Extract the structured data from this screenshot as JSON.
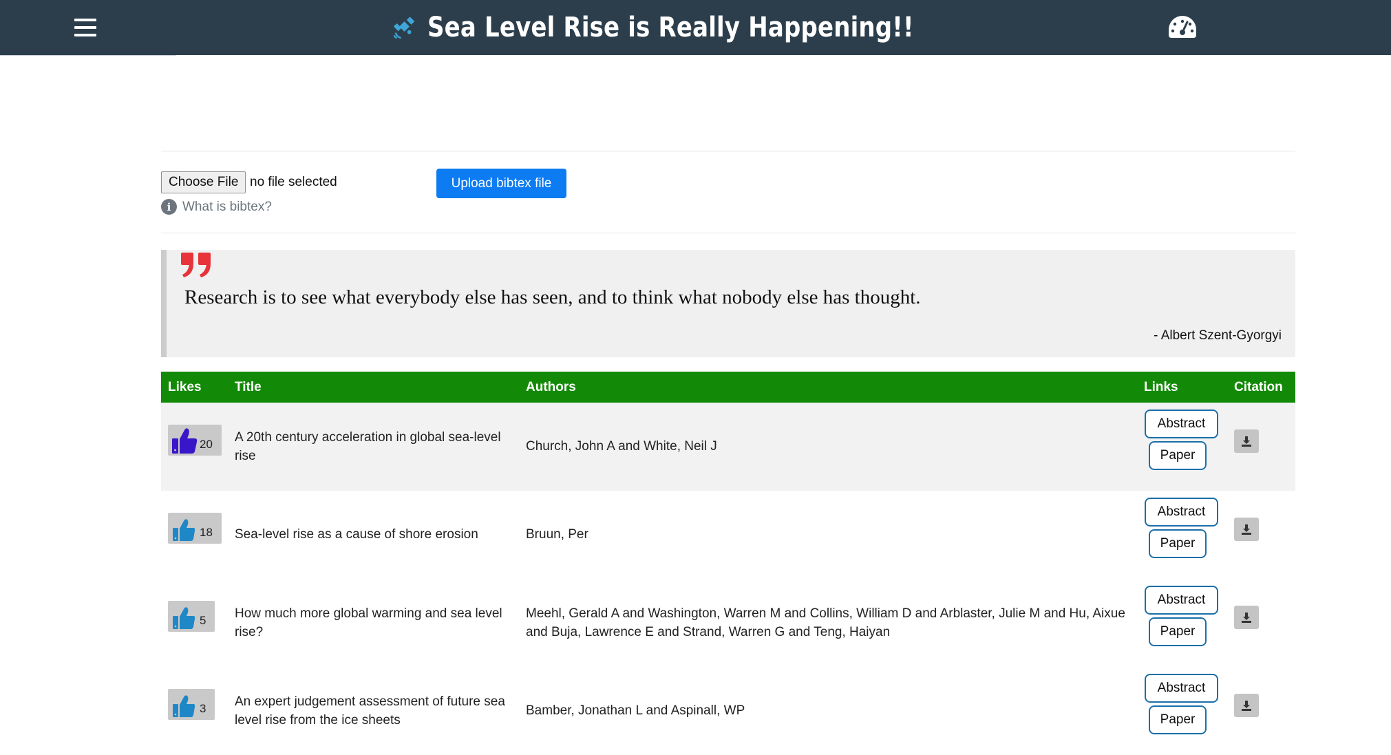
{
  "header": {
    "title": "Sea Level Rise is Really Happening!!",
    "menu_icon": "hamburger-menu-icon",
    "brand_icon": "satellite-icon",
    "dashboard_icon": "dashboard-gauge-icon"
  },
  "upload": {
    "choose_label": "Choose File",
    "file_status": "no file selected",
    "upload_label": "Upload bibtex file",
    "info_label": "What is bibtex?"
  },
  "quote": {
    "text": "Research is to see what everybody else has seen, and to think what nobody else has thought.",
    "author": "- Albert Szent-Gyorgyi",
    "accent_color": "#e8333b"
  },
  "table": {
    "header_color": "#138a07",
    "columns": [
      "Likes",
      "Title",
      "Authors",
      "Links",
      "Citation"
    ],
    "abstract_label": "Abstract",
    "paper_label": "Paper",
    "rows": [
      {
        "likes": "20",
        "title": "A 20th century acceleration in global sea-level rise",
        "authors": "Church, John A and White, Neil J"
      },
      {
        "likes": "18",
        "title": "Sea-level rise as a cause of shore erosion",
        "authors": "Bruun, Per"
      },
      {
        "likes": "5",
        "title": "How much more global warming and sea level rise?",
        "authors": "Meehl, Gerald A and Washington, Warren M and Collins, William D and Arblaster, Julie M and Hu, Aixue and Buja, Lawrence E and Strand, Warren G and Teng, Haiyan"
      },
      {
        "likes": "3",
        "title": "An expert judgement assessment of future sea level rise from the ice sheets",
        "authors": "Bamber, Jonathan L and Aspinall, WP"
      }
    ]
  }
}
